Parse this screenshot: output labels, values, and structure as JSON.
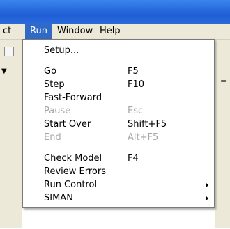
{
  "menubar": {
    "items": [
      {
        "label": "ct"
      },
      {
        "label": "Run"
      },
      {
        "label": "Window"
      },
      {
        "label": "Help"
      }
    ]
  },
  "run_menu": {
    "items": [
      {
        "label": "Setup...",
        "shortcut": "",
        "enabled": true
      },
      {
        "label": "Go",
        "shortcut": "F5",
        "enabled": true
      },
      {
        "label": "Step",
        "shortcut": "F10",
        "enabled": true
      },
      {
        "label": "Fast-Forward",
        "shortcut": "",
        "enabled": true
      },
      {
        "label": "Pause",
        "shortcut": "Esc",
        "enabled": false
      },
      {
        "label": "Start Over",
        "shortcut": "Shift+F5",
        "enabled": true
      },
      {
        "label": "End",
        "shortcut": "Alt+F5",
        "enabled": false
      },
      {
        "label": "Check Model",
        "shortcut": "F4",
        "enabled": true
      },
      {
        "label": "Review Errors",
        "shortcut": "",
        "enabled": true
      },
      {
        "label": "Run Control",
        "shortcut": "",
        "enabled": true,
        "submenu": true
      },
      {
        "label": "SIMAN",
        "shortcut": "",
        "enabled": true,
        "submenu": true
      }
    ]
  },
  "colors": {
    "titlebar": "#2a6fe0",
    "menu_highlight": "#316ac5",
    "disabled_text": "#a7a6aa"
  }
}
